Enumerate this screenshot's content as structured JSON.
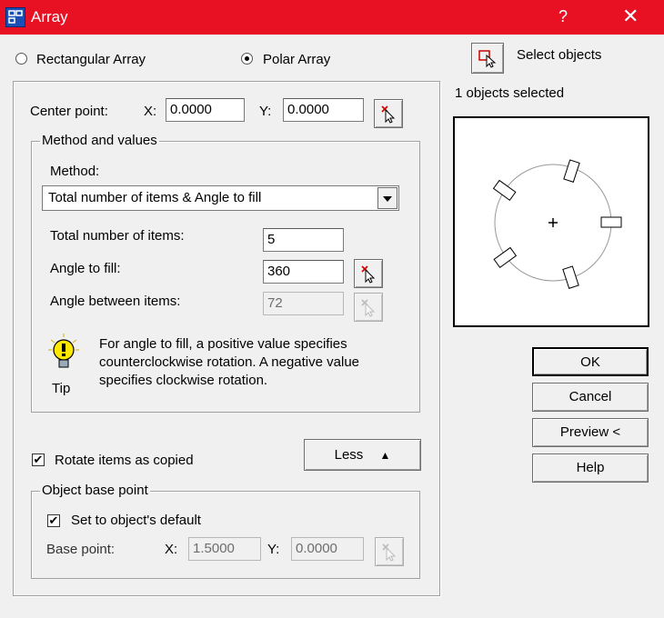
{
  "window": {
    "title": "Array",
    "help": "?",
    "close": "✕"
  },
  "mode": {
    "rectangular": "Rectangular Array",
    "polar": "Polar Array",
    "selected": "polar"
  },
  "select_objects": {
    "label": "Select objects",
    "status": "1 objects selected"
  },
  "center_point": {
    "label": "Center point:",
    "x_label": "X:",
    "x_value": "0.0000",
    "y_label": "Y:",
    "y_value": "0.0000"
  },
  "method_group": {
    "title": "Method and values",
    "method_label": "Method:",
    "method_value": "Total number of items & Angle to fill",
    "total_items_label": "Total number of items:",
    "total_items_value": "5",
    "angle_fill_label": "Angle to fill:",
    "angle_fill_value": "360",
    "angle_between_label": "Angle between items:",
    "angle_between_value": "72"
  },
  "tip": {
    "label": "Tip",
    "text": "For angle to fill, a positive value specifies counterclockwise rotation.  A negative value specifies clockwise rotation."
  },
  "rotate_items": {
    "label": "Rotate items as copied",
    "checked": true
  },
  "less_button": {
    "label": "Less"
  },
  "base_point_group": {
    "title": "Object base point",
    "default_label": "Set to object's default",
    "default_checked": true,
    "base_label": "Base point:",
    "x_label": "X:",
    "x_value": "1.5000",
    "y_label": "Y:",
    "y_value": "0.0000"
  },
  "buttons": {
    "ok": "OK",
    "cancel": "Cancel",
    "preview": "Preview <",
    "help": "Help"
  },
  "colors": {
    "titlebar": "#e81123",
    "dialog": "#f0f0f0"
  },
  "icons": [
    "array-app-icon",
    "pick-point-icon",
    "select-objects-icon",
    "tip-lightbulb-icon",
    "double-up-arrow-icon"
  ]
}
